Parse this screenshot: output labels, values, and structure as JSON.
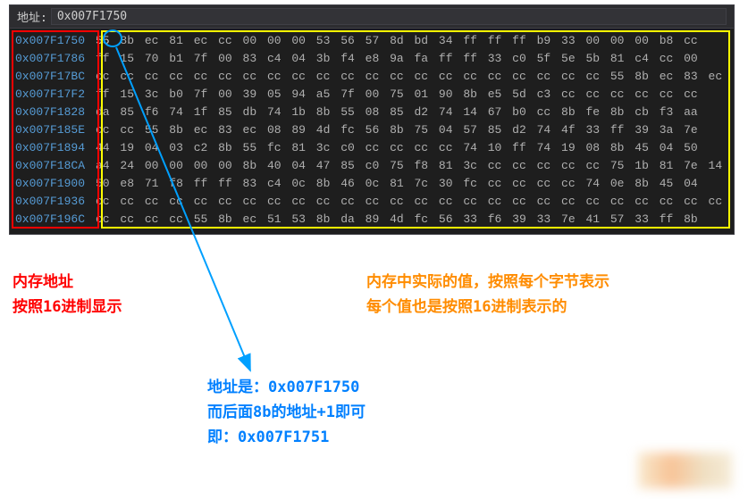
{
  "address_bar": {
    "label": "地址:",
    "value": "0x007F1750"
  },
  "rows": [
    {
      "addr": "0x007F1750",
      "bytes": [
        "55",
        "8b",
        "ec",
        "81",
        "ec",
        "cc",
        "00",
        "00",
        "00",
        "53",
        "56",
        "57",
        "8d",
        "bd",
        "34",
        "ff",
        "ff",
        "ff",
        "b9",
        "33",
        "00",
        "00",
        "00",
        "b8",
        "cc"
      ]
    },
    {
      "addr": "0x007F1786",
      "bytes": [
        "ff",
        "15",
        "70",
        "b1",
        "7f",
        "00",
        "83",
        "c4",
        "04",
        "3b",
        "f4",
        "e8",
        "9a",
        "fa",
        "ff",
        "ff",
        "33",
        "c0",
        "5f",
        "5e",
        "5b",
        "81",
        "c4",
        "cc",
        "00"
      ]
    },
    {
      "addr": "0x007F17BC",
      "bytes": [
        "cc",
        "cc",
        "cc",
        "cc",
        "cc",
        "cc",
        "cc",
        "cc",
        "cc",
        "cc",
        "cc",
        "cc",
        "cc",
        "cc",
        "cc",
        "cc",
        "cc",
        "cc",
        "cc",
        "cc",
        "cc",
        "55",
        "8b",
        "ec",
        "83",
        "ec"
      ]
    },
    {
      "addr": "0x007F17F2",
      "bytes": [
        "ff",
        "15",
        "3c",
        "b0",
        "7f",
        "00",
        "39",
        "05",
        "94",
        "a5",
        "7f",
        "00",
        "75",
        "01",
        "90",
        "8b",
        "e5",
        "5d",
        "c3",
        "cc",
        "cc",
        "cc",
        "cc",
        "cc",
        "cc"
      ]
    },
    {
      "addr": "0x007F1828",
      "bytes": [
        "da",
        "85",
        "f6",
        "74",
        "1f",
        "85",
        "db",
        "74",
        "1b",
        "8b",
        "55",
        "08",
        "85",
        "d2",
        "74",
        "14",
        "67",
        "b0",
        "cc",
        "8b",
        "fe",
        "8b",
        "cb",
        "f3",
        "aa"
      ]
    },
    {
      "addr": "0x007F185E",
      "bytes": [
        "cc",
        "cc",
        "55",
        "8b",
        "ec",
        "83",
        "ec",
        "08",
        "89",
        "4d",
        "fc",
        "56",
        "8b",
        "75",
        "04",
        "57",
        "85",
        "d2",
        "74",
        "4f",
        "33",
        "ff",
        "39",
        "3a",
        "7e"
      ]
    },
    {
      "addr": "0x007F1894",
      "bytes": [
        "44",
        "19",
        "04",
        "03",
        "c2",
        "8b",
        "55",
        "fc",
        "81",
        "3c",
        "c0",
        "cc",
        "cc",
        "cc",
        "cc",
        "74",
        "10",
        "ff",
        "74",
        "19",
        "08",
        "8b",
        "45",
        "04",
        "50"
      ]
    },
    {
      "addr": "0x007F18CA",
      "bytes": [
        "a4",
        "24",
        "00",
        "00",
        "00",
        "00",
        "8b",
        "40",
        "04",
        "47",
        "85",
        "c0",
        "75",
        "f8",
        "81",
        "3c",
        "cc",
        "cc",
        "cc",
        "cc",
        "cc",
        "75",
        "1b",
        "81",
        "7e",
        "14"
      ]
    },
    {
      "addr": "0x007F1900",
      "bytes": [
        "50",
        "e8",
        "71",
        "f8",
        "ff",
        "ff",
        "83",
        "c4",
        "0c",
        "8b",
        "46",
        "0c",
        "81",
        "7c",
        "30",
        "fc",
        "cc",
        "cc",
        "cc",
        "cc",
        "74",
        "0e",
        "8b",
        "45",
        "04"
      ]
    },
    {
      "addr": "0x007F1936",
      "bytes": [
        "cc",
        "cc",
        "cc",
        "cc",
        "cc",
        "cc",
        "cc",
        "cc",
        "cc",
        "cc",
        "cc",
        "cc",
        "cc",
        "cc",
        "cc",
        "cc",
        "cc",
        "cc",
        "cc",
        "cc",
        "cc",
        "cc",
        "cc",
        "cc",
        "cc",
        "cc"
      ]
    },
    {
      "addr": "0x007F196C",
      "bytes": [
        "cc",
        "cc",
        "cc",
        "cc",
        "55",
        "8b",
        "ec",
        "51",
        "53",
        "8b",
        "da",
        "89",
        "4d",
        "fc",
        "56",
        "33",
        "f6",
        "39",
        "33",
        "7e",
        "41",
        "57",
        "33",
        "ff",
        "8b"
      ]
    }
  ],
  "notes": {
    "left1": "内存地址",
    "left2": "按照16进制显示",
    "right1": "内存中实际的值，按照每个字节表示",
    "right2": "每个值也是按照16进制表示的",
    "blue1": "地址是：0x007F1750",
    "blue2": "而后面8b的地址+1即可",
    "blue3": "即：0x007F1751"
  }
}
